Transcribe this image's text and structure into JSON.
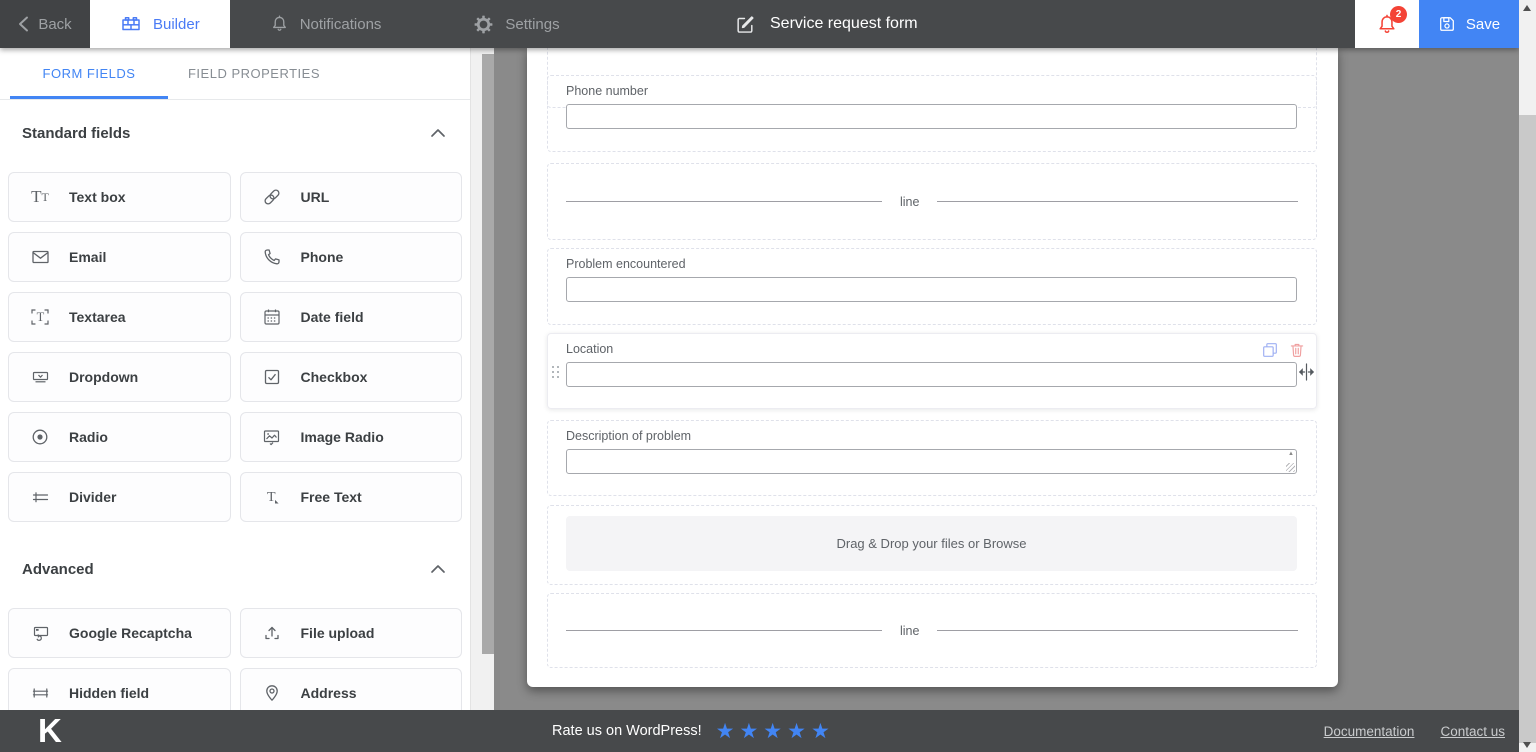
{
  "topbar": {
    "back_label": "Back",
    "builder_tab": "Builder",
    "notifications_tab": "Notifications",
    "settings_tab": "Settings",
    "title": "Service request form",
    "notification_count": "2",
    "save_label": "Save"
  },
  "sidebar": {
    "tabs": {
      "form_fields": "FORM FIELDS",
      "field_properties": "FIELD PROPERTIES"
    },
    "standard": {
      "title": "Standard fields",
      "items": [
        {
          "label": "Text box",
          "icon": "textbox-icon"
        },
        {
          "label": "URL",
          "icon": "url-icon"
        },
        {
          "label": "Email",
          "icon": "email-icon"
        },
        {
          "label": "Phone",
          "icon": "phone-icon"
        },
        {
          "label": "Textarea",
          "icon": "textarea-icon"
        },
        {
          "label": "Date field",
          "icon": "calendar-icon"
        },
        {
          "label": "Dropdown",
          "icon": "dropdown-icon"
        },
        {
          "label": "Checkbox",
          "icon": "checkbox-icon"
        },
        {
          "label": "Radio",
          "icon": "radio-icon"
        },
        {
          "label": "Image Radio",
          "icon": "image-radio-icon"
        },
        {
          "label": "Divider",
          "icon": "divider-icon"
        },
        {
          "label": "Free Text",
          "icon": "free-text-icon"
        }
      ]
    },
    "advanced": {
      "title": "Advanced",
      "items": [
        {
          "label": "Google Recaptcha",
          "icon": "recaptcha-icon"
        },
        {
          "label": "File upload",
          "icon": "file-upload-icon"
        },
        {
          "label": "Hidden field",
          "icon": "hidden-field-icon"
        },
        {
          "label": "Address",
          "icon": "map-pin-icon"
        }
      ]
    }
  },
  "form": {
    "fields": {
      "phone": {
        "label": "Phone number",
        "value": ""
      },
      "divider1": {
        "text": "line"
      },
      "problem": {
        "label": "Problem encountered",
        "value": ""
      },
      "location": {
        "label": "Location",
        "value": ""
      },
      "description": {
        "label": "Description of problem",
        "value": ""
      },
      "upload": {
        "text": "Drag & Drop your files or Browse"
      },
      "divider2": {
        "text": "line"
      }
    }
  },
  "footer": {
    "logo": "K",
    "rate_text": "Rate us on WordPress!",
    "star_count": 5,
    "links": {
      "documentation": "Documentation",
      "contact": "Contact us"
    }
  },
  "colors": {
    "accent": "#4285f4",
    "danger": "#f44336",
    "topbar": "#47494b",
    "canvas": "#8a8a8a"
  }
}
